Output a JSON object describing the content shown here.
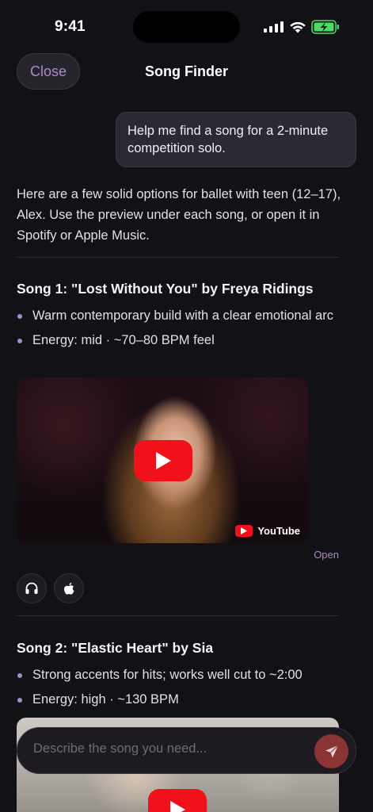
{
  "status_bar": {
    "time": "9:41"
  },
  "header": {
    "close_label": "Close",
    "title": "Song Finder"
  },
  "chat": {
    "user_message": "Help me find a song for a 2-minute competition solo.",
    "intro": "Here are a few solid options for ballet with teen (12–17), Alex. Use the preview under each song, or open it in Spotify or Apple Music."
  },
  "songs": [
    {
      "title": "Song 1: \"Lost Without You\" by Freya Ridings",
      "bullets": [
        "Warm contemporary build with a clear emotional arc",
        "Energy: mid · ~70–80 BPM feel"
      ],
      "video_badge": "YouTube",
      "open_label": "Open",
      "actions": [
        {
          "icon": "headphones-icon"
        },
        {
          "icon": "apple-icon"
        }
      ]
    },
    {
      "title": "Song 2: \"Elastic Heart\" by Sia",
      "bullets": [
        "Strong accents for hits; works well cut to ~2:00",
        "Energy: high · ~130 BPM"
      ]
    }
  ],
  "composer": {
    "placeholder": "Describe the song you need..."
  },
  "colors": {
    "accent": "#A88BC9",
    "background": "#121115",
    "play_red": "#F0111A",
    "send": "#8A3434"
  }
}
